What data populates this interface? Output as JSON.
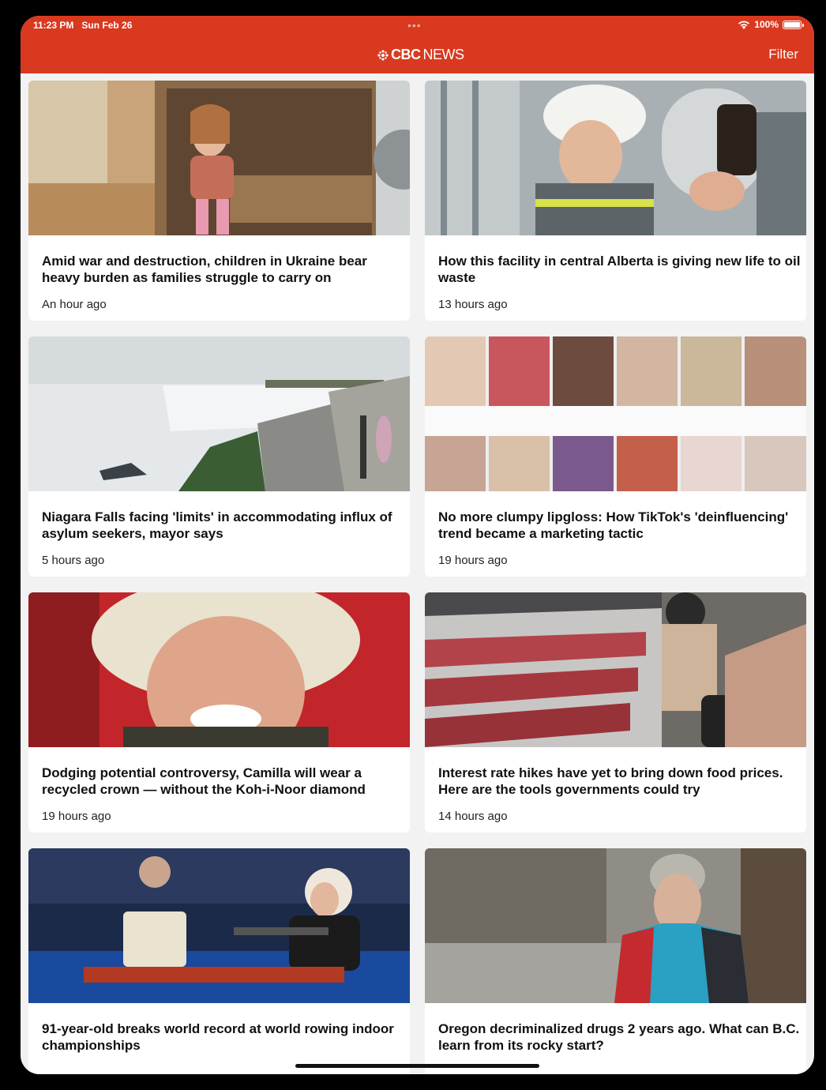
{
  "status_bar": {
    "time": "11:23 PM",
    "date": "Sun Feb 26",
    "battery": "100%"
  },
  "header": {
    "logo_cbc": "CBC",
    "logo_news": "NEWS",
    "filter_label": "Filter",
    "accent_color": "#d9391f"
  },
  "stories": [
    {
      "title": "Amid war and destruction, children in Ukraine bear heavy burden as families struggle to carry on",
      "time": "An hour ago",
      "image": "child-sitting-in-closet-photo"
    },
    {
      "title": "How this facility in central Alberta is giving new life to oil waste",
      "time": "13 hours ago",
      "image": "worker-holding-oil-sample-photo"
    },
    {
      "title": "Niagara Falls facing 'limits' in accommodating influx of asylum seekers, mayor says",
      "time": "5 hours ago",
      "image": "niagara-falls-photo"
    },
    {
      "title": "No more clumpy lipgloss: How TikTok's 'deinfluencing' trend became a marketing tactic",
      "time": "19 hours ago",
      "image": "tiktok-collage-photo"
    },
    {
      "title": "Dodging potential controversy, Camilla will wear a recycled crown — without the Koh-i-Noor diamond",
      "time": "19 hours ago",
      "image": "camilla-portrait-photo"
    },
    {
      "title": "Interest rate hikes have yet to bring down food prices. Here are the tools governments could try",
      "time": "14 hours ago",
      "image": "grocery-meat-aisle-photo"
    },
    {
      "title": "91-year-old breaks world record at world rowing indoor championships",
      "time": "",
      "image": "rowing-machine-photo"
    },
    {
      "title": "Oregon decriminalized drugs 2 years ago. What can B.C. learn from its rocky start?",
      "time": "",
      "image": "man-on-street-photo"
    }
  ]
}
